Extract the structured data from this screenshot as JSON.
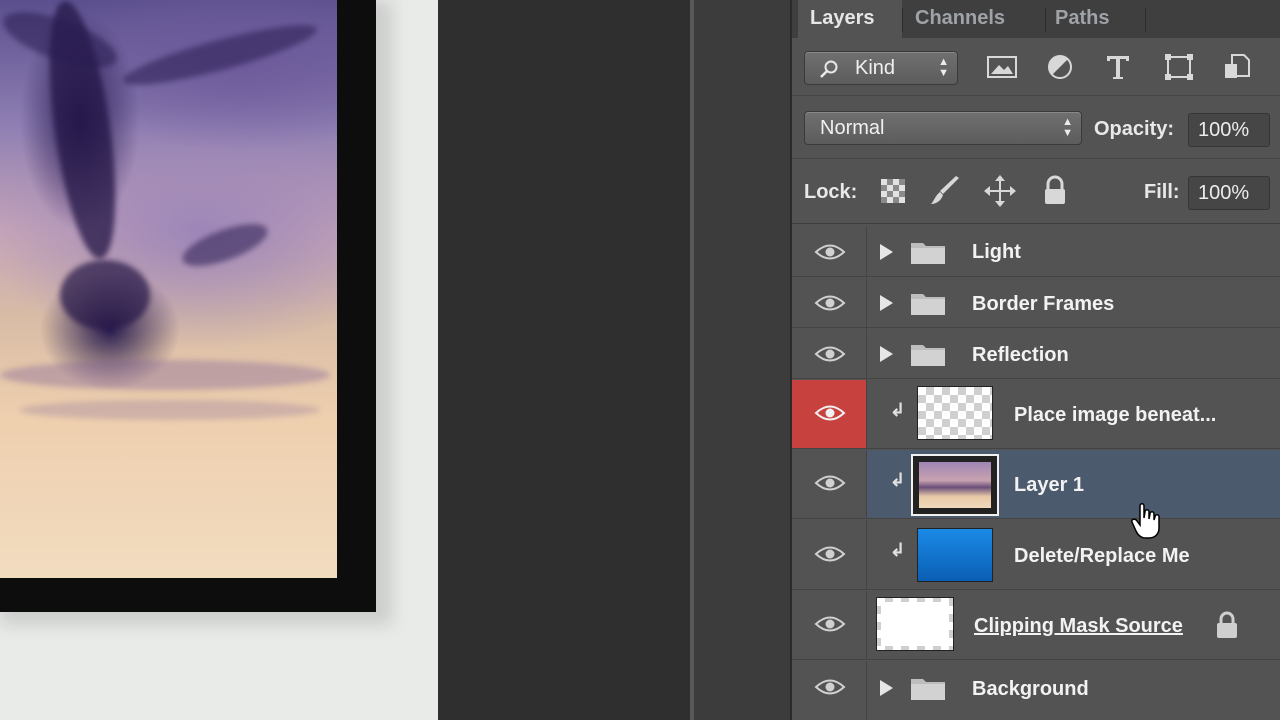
{
  "tabs": [
    {
      "label": "Layers",
      "active": true
    },
    {
      "label": "Channels",
      "active": false
    },
    {
      "label": "Paths",
      "active": false
    }
  ],
  "filter": {
    "kind_label": "Kind",
    "icons": [
      "image-filter-icon",
      "adjustment-filter-icon",
      "type-filter-icon",
      "shape-filter-icon",
      "smart-object-filter-icon"
    ]
  },
  "blend": {
    "mode": "Normal",
    "opacity_label": "Opacity:",
    "opacity_value": "100%"
  },
  "lock": {
    "label": "Lock:",
    "icons": [
      "lock-transparency-icon",
      "lock-image-icon",
      "lock-position-icon",
      "lock-all-icon"
    ],
    "fill_label": "Fill:",
    "fill_value": "100%"
  },
  "layers": [
    {
      "name": "Light",
      "type": "group",
      "visible": true
    },
    {
      "name": "Border Frames",
      "type": "group",
      "visible": true
    },
    {
      "name": "Reflection",
      "type": "group",
      "visible": true
    },
    {
      "name": "Place image beneat...",
      "type": "clipped-layer",
      "visible": true,
      "thumb": "transparent",
      "highlight_color": "#c7413e"
    },
    {
      "name": "Layer 1",
      "type": "clipped-layer",
      "visible": true,
      "thumb": "image",
      "selected": true
    },
    {
      "name": "Delete/Replace Me",
      "type": "clipped-layer",
      "visible": true,
      "thumb": "blue-fill",
      "thumb_color": "#1679d6"
    },
    {
      "name": "Clipping Mask Source",
      "type": "base-layer",
      "visible": true,
      "thumb": "white-shape",
      "locked": true
    },
    {
      "name": "Background",
      "type": "group",
      "visible": true
    }
  ],
  "colors": {
    "panel": "#535353",
    "selected_row": "#4b5a6c",
    "eye_highlight": "#c7413e"
  }
}
